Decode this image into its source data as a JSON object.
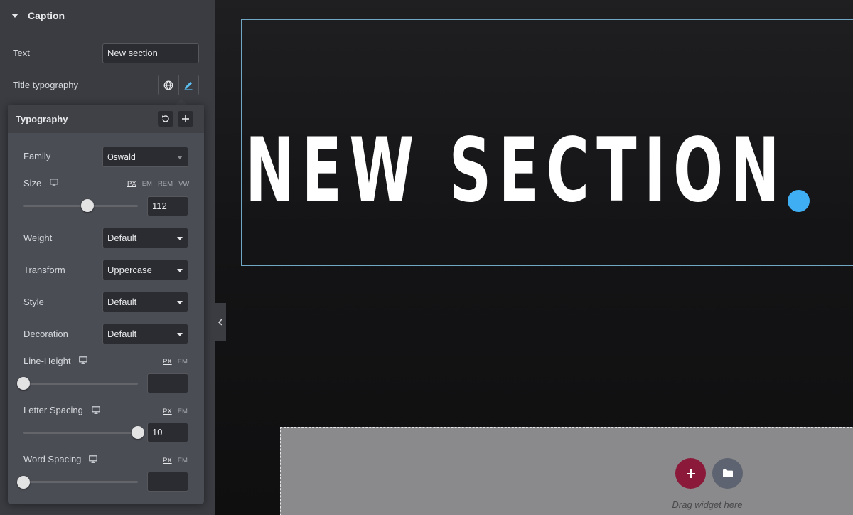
{
  "panel": {
    "section_title": "Caption",
    "text_label": "Text",
    "text_value": "New section",
    "typography_label": "Title typography"
  },
  "typography": {
    "title": "Typography",
    "family": {
      "label": "Family",
      "value": "Oswald"
    },
    "size": {
      "label": "Size",
      "units": [
        "PX",
        "EM",
        "REM",
        "VW"
      ],
      "active_unit": "PX",
      "value": "112",
      "slider_fraction": 0.56
    },
    "weight": {
      "label": "Weight",
      "value": "Default"
    },
    "transform": {
      "label": "Transform",
      "value": "Uppercase"
    },
    "style": {
      "label": "Style",
      "value": "Default"
    },
    "decoration": {
      "label": "Decoration",
      "value": "Default"
    },
    "line_height": {
      "label": "Line-Height",
      "units": [
        "PX",
        "EM"
      ],
      "active_unit": "PX",
      "value": "",
      "slider_fraction": 0.0
    },
    "letter_spacing": {
      "label": "Letter Spacing",
      "units": [
        "PX",
        "EM"
      ],
      "active_unit": "PX",
      "value": "10",
      "slider_fraction": 1.0
    },
    "word_spacing": {
      "label": "Word Spacing",
      "units": [
        "PX",
        "EM"
      ],
      "active_unit": "PX",
      "value": "",
      "slider_fraction": 0.0
    }
  },
  "canvas": {
    "heading_text": "NEW SECTION",
    "dot_color": "#3faef2",
    "drop_zone_text": "Drag widget here",
    "add_button_color": "#8b1a3a",
    "template_button_color": "#5d6370"
  },
  "icons": {
    "caret": "caret-down-icon",
    "globe": "globe-icon",
    "pencil": "pencil-icon",
    "reset": "reset-icon",
    "plus": "plus-icon",
    "monitor": "monitor-icon",
    "chevron": "chevron-left-icon",
    "folder": "folder-icon"
  }
}
